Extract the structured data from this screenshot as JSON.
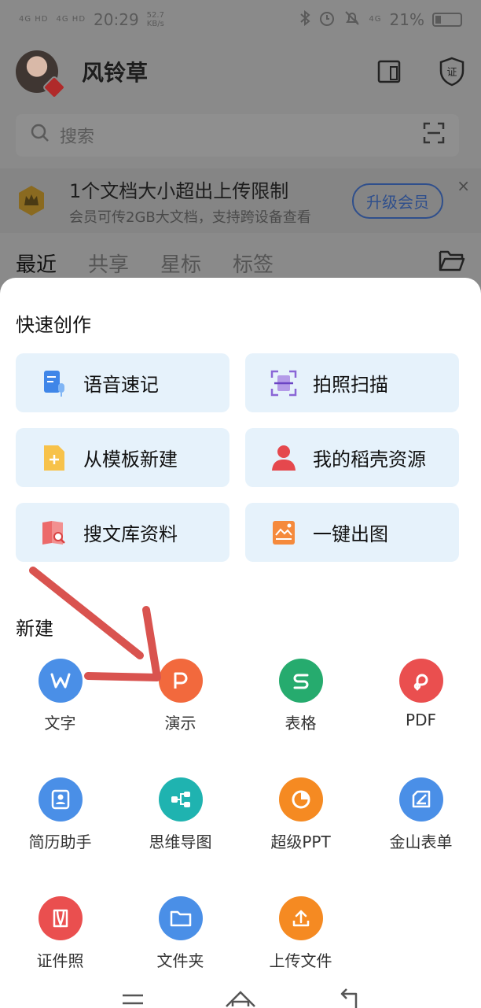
{
  "status_bar": {
    "signal_1": "4G HD",
    "signal_2": "4G HD",
    "time": "20:29",
    "speed_value": "52.7",
    "speed_unit": "KB/s",
    "net_type": "4G",
    "battery": "21%",
    "battery_level": 0.21
  },
  "header": {
    "username": "风铃草"
  },
  "search": {
    "placeholder": "搜索"
  },
  "promo": {
    "title": "1个文档大小超出上传限制",
    "subtitle": "会员可传2GB大文档，支持跨设备查看",
    "upgrade_label": "升级会员",
    "close": "×"
  },
  "tabs": [
    {
      "label": "最近"
    },
    {
      "label": "共享"
    },
    {
      "label": "星标"
    },
    {
      "label": "标签"
    }
  ],
  "quick_create": {
    "title": "快速创作",
    "items": [
      {
        "label": "语音速记",
        "icon": "voice-note-icon"
      },
      {
        "label": "拍照扫描",
        "icon": "scan-icon"
      },
      {
        "label": "从模板新建",
        "icon": "template-icon"
      },
      {
        "label": "我的稻壳资源",
        "icon": "user-resource-icon"
      },
      {
        "label": "搜文库资料",
        "icon": "library-search-icon"
      },
      {
        "label": "一键出图",
        "icon": "image-gen-icon"
      }
    ]
  },
  "new_section": {
    "title": "新建",
    "items": [
      {
        "label": "文字",
        "glyph": "W",
        "color": "#4a8fe7"
      },
      {
        "label": "演示",
        "glyph": "P",
        "color": "#f2693d"
      },
      {
        "label": "表格",
        "glyph": "S",
        "color": "#26ab6e"
      },
      {
        "label": "PDF",
        "glyph": "P",
        "color": "#ea4f4f"
      },
      {
        "label": "简历助手",
        "glyph": "",
        "color": "#4a8fe7"
      },
      {
        "label": "思维导图",
        "glyph": "",
        "color": "#1fb3b0"
      },
      {
        "label": "超级PPT",
        "glyph": "",
        "color": "#f58a22"
      },
      {
        "label": "金山表单",
        "glyph": "",
        "color": "#4a8fe7"
      },
      {
        "label": "证件照",
        "glyph": "",
        "color": "#ea4f4f"
      },
      {
        "label": "文件夹",
        "glyph": "",
        "color": "#4a8fe7"
      },
      {
        "label": "上传文件",
        "glyph": "",
        "color": "#f58a22"
      }
    ]
  },
  "annotation_arrow_color": "#d9534f"
}
